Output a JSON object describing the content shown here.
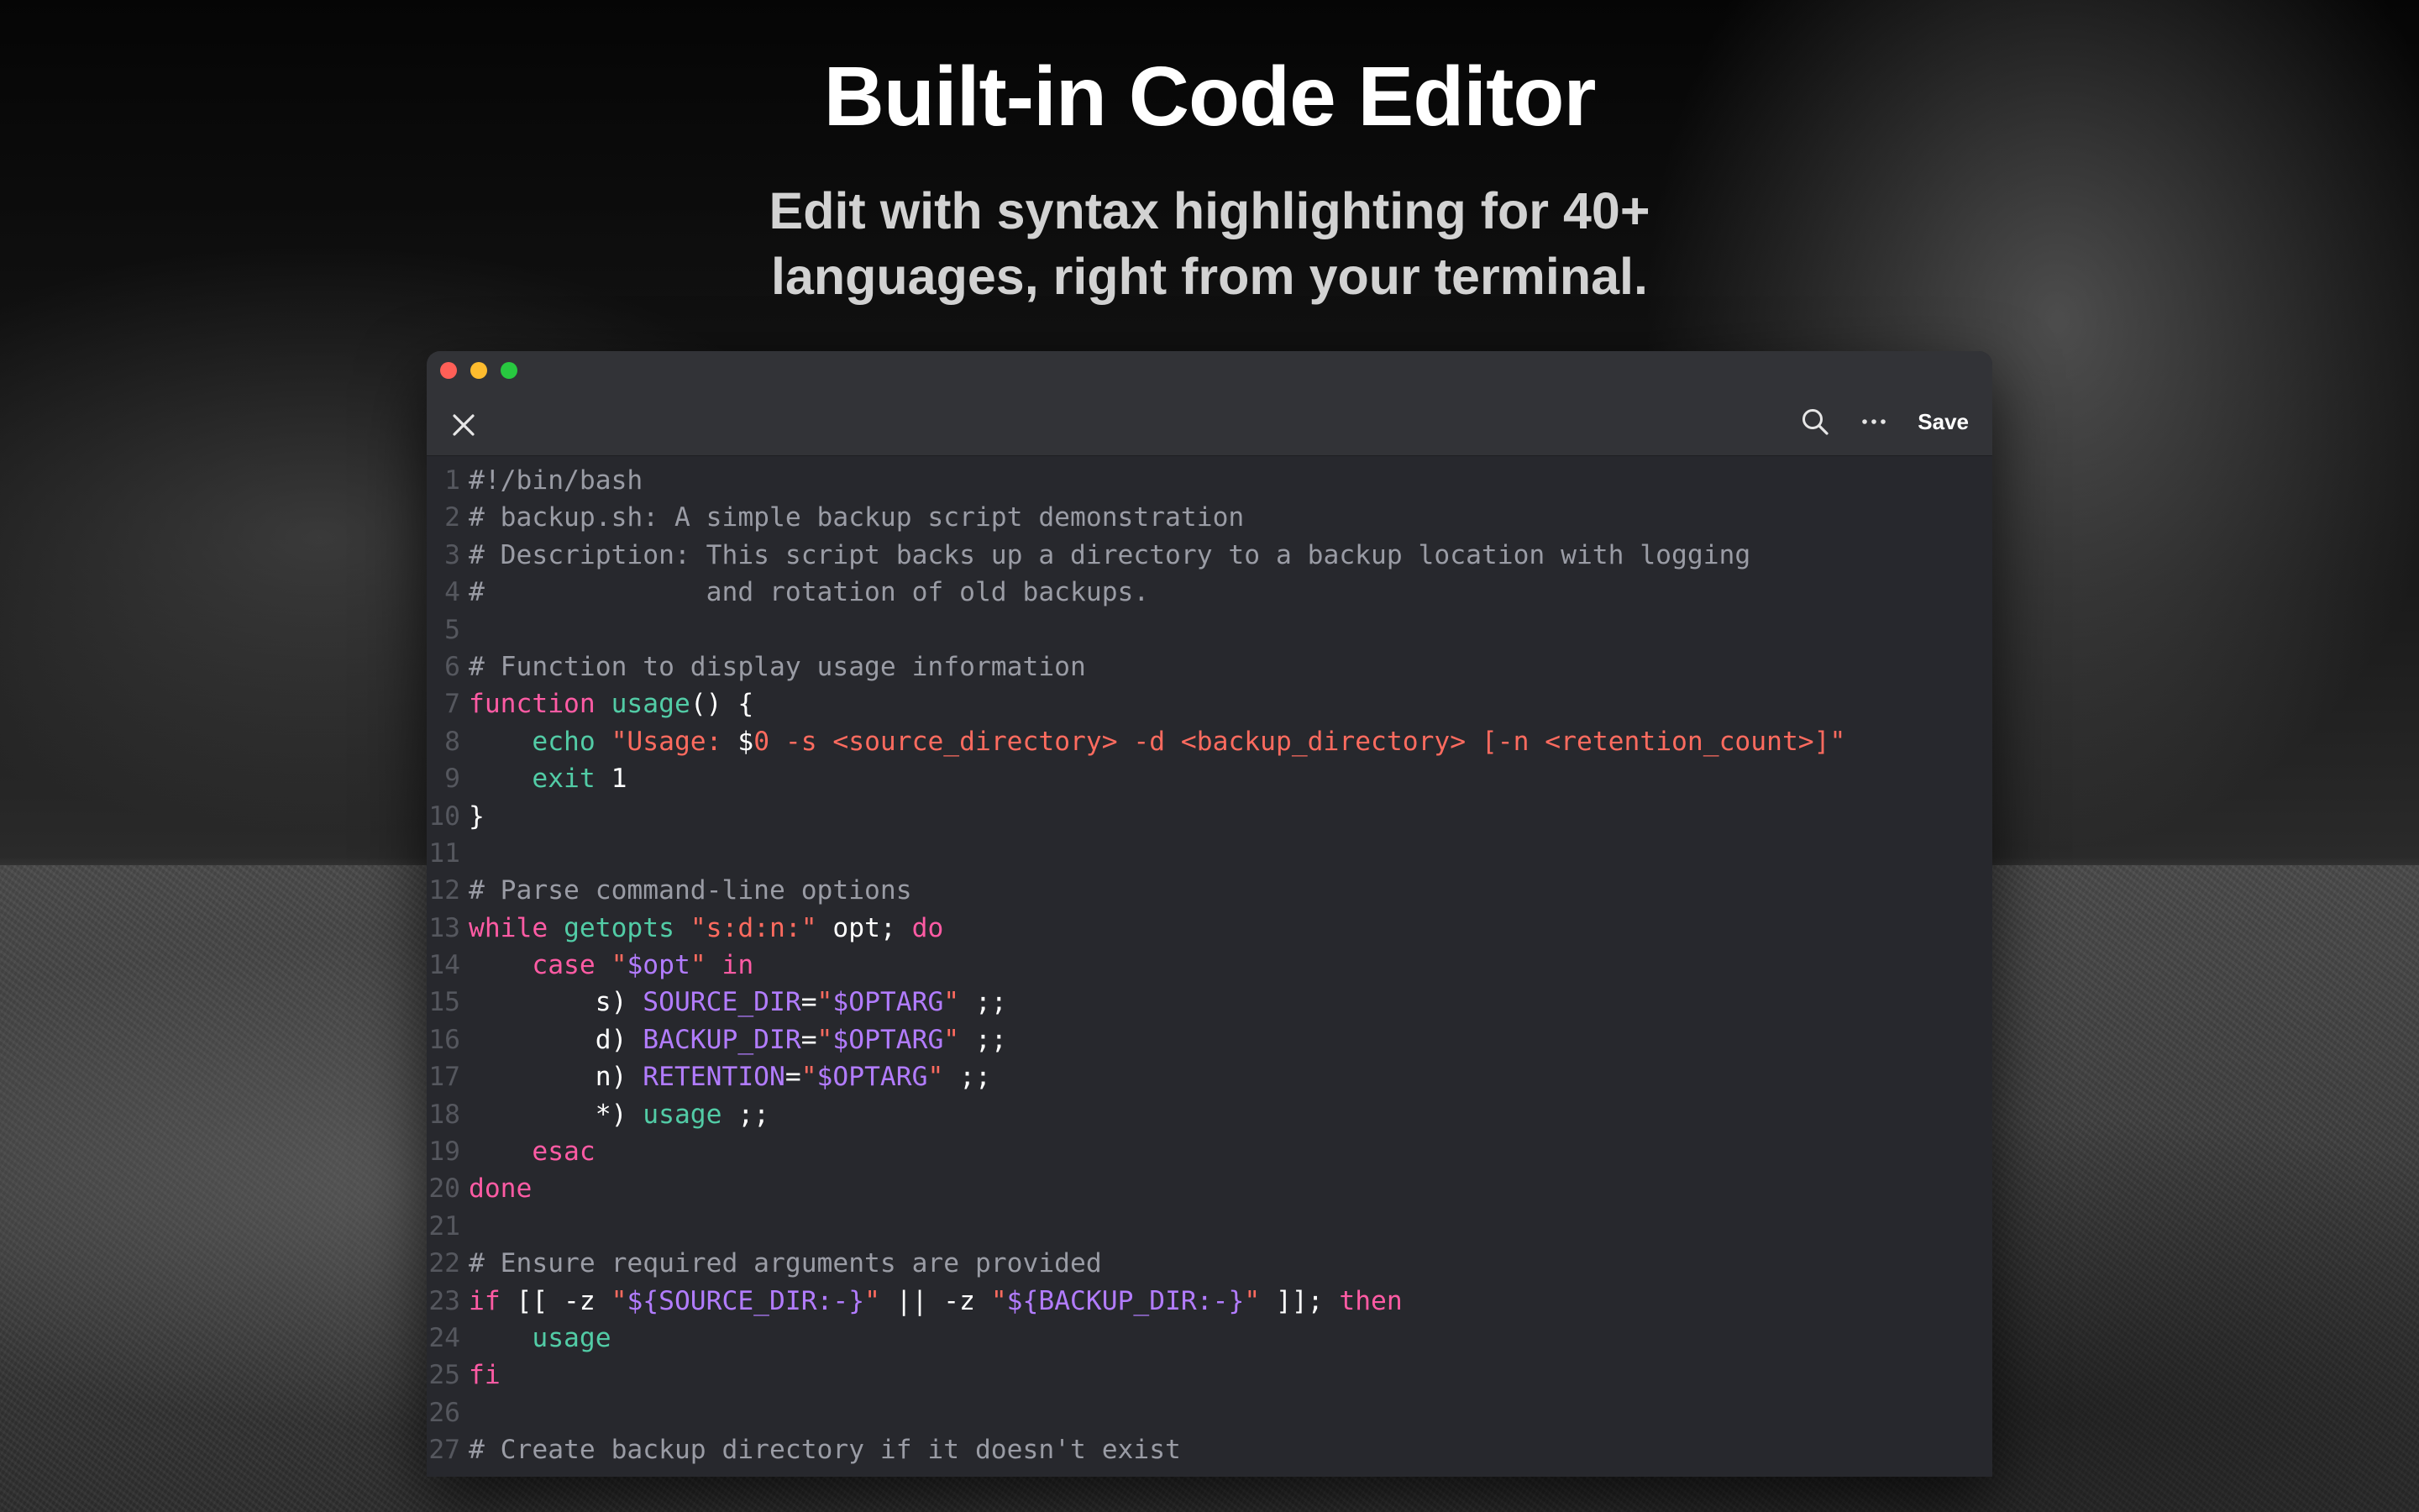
{
  "page": {
    "headline": "Built-in Code Editor",
    "subhead_lines": [
      "Edit with syntax highlighting for 40+",
      "languages, right from your terminal."
    ]
  },
  "editor": {
    "toolbar": {
      "close_icon": "close-icon",
      "search_icon": "search-icon",
      "more_icon": "ellipsis-icon",
      "save_label": "Save"
    },
    "colors": {
      "comment": "#9a9ca5",
      "keyword": "#ff5ba4",
      "function": "#52cca6",
      "string": "#ff6b5f",
      "variable": "#b27cff",
      "text": "#ffffff",
      "background": "#27282d"
    },
    "lines": [
      {
        "n": "1",
        "segs": [
          [
            "com",
            "#!/bin/bash"
          ]
        ]
      },
      {
        "n": "2",
        "segs": [
          [
            "com",
            "# backup.sh: A simple backup script demonstration"
          ]
        ]
      },
      {
        "n": "3",
        "segs": [
          [
            "com",
            "# Description: This script backs up a directory to a backup location with logging"
          ]
        ]
      },
      {
        "n": "4",
        "segs": [
          [
            "com",
            "#              and rotation of old backups."
          ]
        ]
      },
      {
        "n": "5",
        "segs": []
      },
      {
        "n": "6",
        "segs": [
          [
            "com",
            "# Function to display usage information"
          ]
        ]
      },
      {
        "n": "7",
        "segs": [
          [
            "key",
            "function"
          ],
          [
            "def",
            " "
          ],
          [
            "fn",
            "usage"
          ],
          [
            "def",
            "() {"
          ]
        ]
      },
      {
        "n": "8",
        "segs": [
          [
            "def",
            "    "
          ],
          [
            "fn",
            "echo"
          ],
          [
            "def",
            " "
          ],
          [
            "str",
            "\"Usage: "
          ],
          [
            "def",
            "$"
          ],
          [
            "str",
            "0 -s <source_directory> -d <backup_directory> [-n <retention_count>]\""
          ]
        ]
      },
      {
        "n": "9",
        "segs": [
          [
            "def",
            "    "
          ],
          [
            "fn",
            "exit"
          ],
          [
            "def",
            " 1"
          ]
        ]
      },
      {
        "n": "10",
        "segs": [
          [
            "def",
            "}"
          ]
        ]
      },
      {
        "n": "11",
        "segs": []
      },
      {
        "n": "12",
        "segs": [
          [
            "com",
            "# Parse command-line options"
          ]
        ]
      },
      {
        "n": "13",
        "segs": [
          [
            "key",
            "while"
          ],
          [
            "def",
            " "
          ],
          [
            "fn",
            "getopts"
          ],
          [
            "def",
            " "
          ],
          [
            "str",
            "\"s:d:n:\""
          ],
          [
            "def",
            " opt; "
          ],
          [
            "key",
            "do"
          ]
        ]
      },
      {
        "n": "14",
        "segs": [
          [
            "def",
            "    "
          ],
          [
            "key",
            "case"
          ],
          [
            "def",
            " "
          ],
          [
            "str",
            "\""
          ],
          [
            "var",
            "$opt"
          ],
          [
            "str",
            "\""
          ],
          [
            "def",
            " "
          ],
          [
            "key",
            "in"
          ]
        ]
      },
      {
        "n": "15",
        "segs": [
          [
            "def",
            "        s) "
          ],
          [
            "var",
            "SOURCE_DIR"
          ],
          [
            "def",
            "="
          ],
          [
            "str",
            "\""
          ],
          [
            "var",
            "$OPTARG"
          ],
          [
            "str",
            "\""
          ],
          [
            "def",
            " ;;"
          ]
        ]
      },
      {
        "n": "16",
        "segs": [
          [
            "def",
            "        d) "
          ],
          [
            "var",
            "BACKUP_DIR"
          ],
          [
            "def",
            "="
          ],
          [
            "str",
            "\""
          ],
          [
            "var",
            "$OPTARG"
          ],
          [
            "str",
            "\""
          ],
          [
            "def",
            " ;;"
          ]
        ]
      },
      {
        "n": "17",
        "segs": [
          [
            "def",
            "        n) "
          ],
          [
            "var",
            "RETENTION"
          ],
          [
            "def",
            "="
          ],
          [
            "str",
            "\""
          ],
          [
            "var",
            "$OPTARG"
          ],
          [
            "str",
            "\""
          ],
          [
            "def",
            " ;;"
          ]
        ]
      },
      {
        "n": "18",
        "segs": [
          [
            "def",
            "        *) "
          ],
          [
            "fn",
            "usage"
          ],
          [
            "def",
            " ;;"
          ]
        ]
      },
      {
        "n": "19",
        "segs": [
          [
            "def",
            "    "
          ],
          [
            "key",
            "esac"
          ]
        ]
      },
      {
        "n": "20",
        "segs": [
          [
            "key",
            "done"
          ]
        ]
      },
      {
        "n": "21",
        "segs": []
      },
      {
        "n": "22",
        "segs": [
          [
            "com",
            "# Ensure required arguments are provided"
          ]
        ]
      },
      {
        "n": "23",
        "segs": [
          [
            "key",
            "if"
          ],
          [
            "def",
            " [[ -z "
          ],
          [
            "str",
            "\""
          ],
          [
            "var",
            "${SOURCE_DIR:-}"
          ],
          [
            "str",
            "\""
          ],
          [
            "def",
            " || -z "
          ],
          [
            "str",
            "\""
          ],
          [
            "var",
            "${BACKUP_DIR:-}"
          ],
          [
            "str",
            "\""
          ],
          [
            "def",
            " ]]; "
          ],
          [
            "key",
            "then"
          ]
        ]
      },
      {
        "n": "24",
        "segs": [
          [
            "def",
            "    "
          ],
          [
            "fn",
            "usage"
          ]
        ]
      },
      {
        "n": "25",
        "segs": [
          [
            "key",
            "fi"
          ]
        ]
      },
      {
        "n": "26",
        "segs": []
      },
      {
        "n": "27",
        "segs": [
          [
            "com",
            "# Create backup directory if it doesn't exist"
          ]
        ]
      }
    ]
  }
}
